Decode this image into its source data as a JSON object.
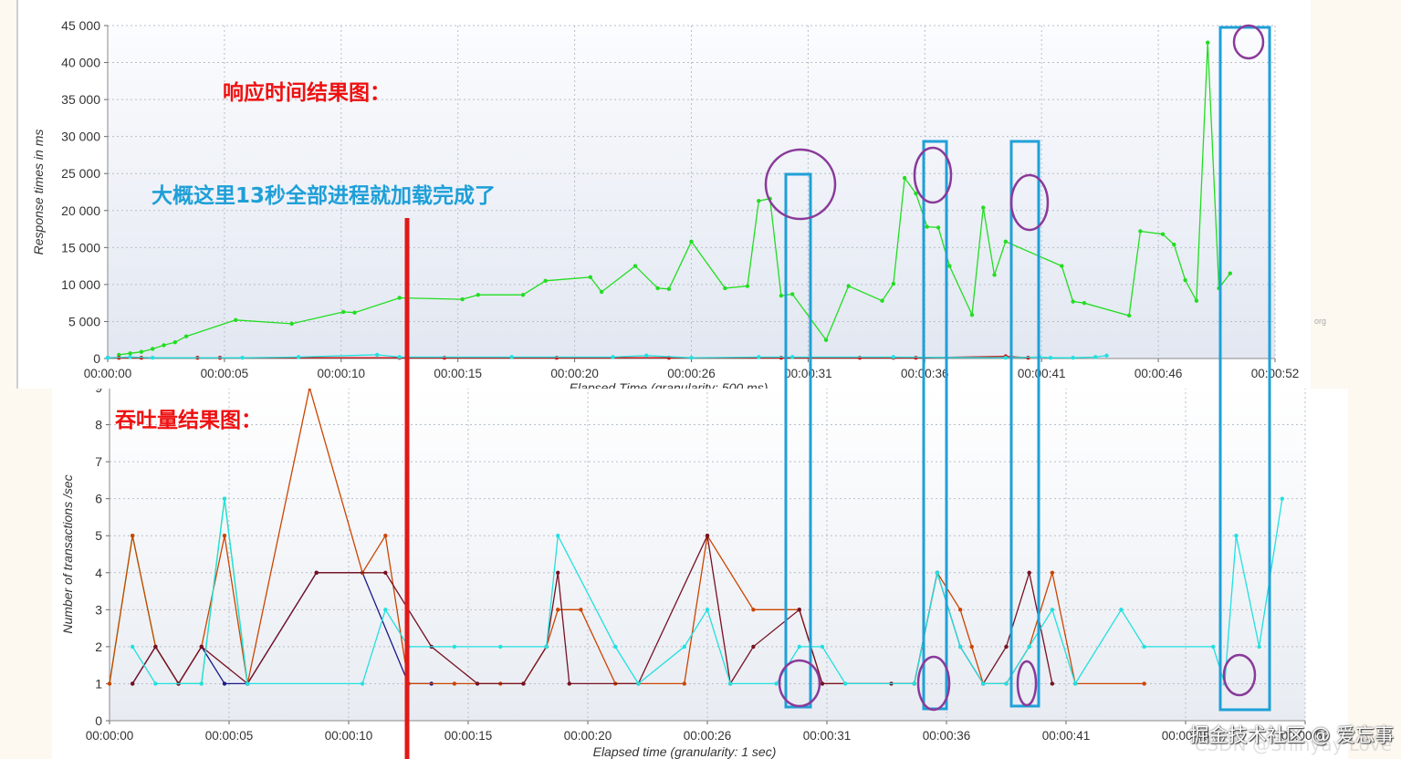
{
  "annotations": {
    "response_title": "响应时间结果图：",
    "throughput_title": "吞吐量结果图：",
    "load_note": "大概这里13秒全部进程就加载完成了"
  },
  "watermark": {
    "front": "掘金技术社区 @ 爱忘事",
    "back": "CSDN @Shinyay Love"
  },
  "org_tag": "org",
  "colors": {
    "green": "#22dd22",
    "red": "#cc1111",
    "cyan": "#22e0e0",
    "orange": "#cc4400",
    "darkred": "#771122",
    "navy": "#1a1a88",
    "annotation_red": "#ee1111",
    "annotation_blue": "#1e9fd8",
    "box_blue": "#1fa0d8",
    "circle_purple": "#8a3a9a",
    "marker_line": "#e21818"
  },
  "chart_data": [
    {
      "type": "line",
      "ylabel": "Response times in ms",
      "xlabel": "Elapsed Time (granularity: 500 ms)",
      "ylim": [
        0,
        45000
      ],
      "xlim": [
        0,
        52
      ],
      "yticks": [
        "0",
        "5 000",
        "10 000",
        "15 000",
        "20 000",
        "25 000",
        "30 000",
        "35 000",
        "40 000",
        "45 000"
      ],
      "xticks": [
        "00:00:00",
        "00:00:05",
        "00:00:10",
        "00:00:15",
        "00:00:20",
        "00:00:26",
        "00:00:31",
        "00:00:36",
        "00:00:41",
        "00:00:46",
        "00:00:52"
      ],
      "grid": true,
      "series": [
        {
          "color": "green",
          "points": [
            [
              0.5,
              500
            ],
            [
              1,
              700
            ],
            [
              1.5,
              900
            ],
            [
              2,
              1300
            ],
            [
              2.5,
              1800
            ],
            [
              3,
              2200
            ],
            [
              3.5,
              3000
            ],
            [
              5.7,
              5200
            ],
            [
              8.2,
              4700
            ],
            [
              10.5,
              6300
            ],
            [
              11,
              6200
            ],
            [
              13,
              8200
            ],
            [
              15.8,
              8000
            ],
            [
              16.5,
              8600
            ],
            [
              18.5,
              8600
            ],
            [
              19.5,
              10500
            ],
            [
              21.5,
              11000
            ],
            [
              22,
              9000
            ],
            [
              23.5,
              12500
            ],
            [
              24.5,
              9500
            ],
            [
              25,
              9400
            ],
            [
              26,
              15800
            ],
            [
              27.5,
              9500
            ],
            [
              28.5,
              9800
            ],
            [
              29,
              21300
            ],
            [
              29.5,
              21600
            ],
            [
              30,
              8500
            ],
            [
              30.5,
              8700
            ],
            [
              32,
              2500
            ],
            [
              33,
              9800
            ],
            [
              34.5,
              7800
            ],
            [
              35,
              10100
            ],
            [
              35.5,
              24400
            ],
            [
              36,
              22300
            ],
            [
              36.5,
              17800
            ],
            [
              37,
              17700
            ],
            [
              37.5,
              12500
            ],
            [
              38.5,
              5900
            ],
            [
              39,
              20400
            ],
            [
              39.5,
              11300
            ],
            [
              40,
              15800
            ],
            [
              42.5,
              12500
            ],
            [
              43,
              7700
            ],
            [
              43.5,
              7500
            ],
            [
              45.5,
              5800
            ],
            [
              46,
              17200
            ],
            [
              47,
              16800
            ],
            [
              47.5,
              15400
            ],
            [
              48,
              10600
            ],
            [
              48.5,
              7800
            ],
            [
              49,
              42700
            ],
            [
              49.5,
              9500
            ],
            [
              50,
              11500
            ]
          ]
        },
        {
          "color": "red",
          "points": [
            [
              0,
              100
            ],
            [
              0.5,
              100
            ],
            [
              1.5,
              100
            ],
            [
              4,
              100
            ],
            [
              5,
              100
            ],
            [
              13,
              100
            ],
            [
              15,
              100
            ],
            [
              20,
              100
            ],
            [
              25,
              100
            ],
            [
              30,
              100
            ],
            [
              33.5,
              100
            ],
            [
              35,
              100
            ],
            [
              36,
              100
            ],
            [
              40,
              300
            ],
            [
              41,
              100
            ]
          ]
        },
        {
          "color": "cyan",
          "points": [
            [
              0,
              100
            ],
            [
              1,
              200
            ],
            [
              2,
              100
            ],
            [
              6,
              100
            ],
            [
              8.5,
              200
            ],
            [
              12,
              500
            ],
            [
              13,
              200
            ],
            [
              18,
              200
            ],
            [
              22.5,
              200
            ],
            [
              24,
              400
            ],
            [
              26,
              100
            ],
            [
              29,
              200
            ],
            [
              30.5,
              200
            ],
            [
              35,
              200
            ],
            [
              40,
              100
            ],
            [
              41.5,
              200
            ],
            [
              42,
              100
            ],
            [
              43,
              100
            ],
            [
              44,
              200
            ],
            [
              44.5,
              400
            ]
          ]
        }
      ]
    },
    {
      "type": "line",
      "ylabel": "Number of transactions /sec",
      "xlabel": "Elapsed time (granularity: 1 sec)",
      "ylim": [
        0,
        9
      ],
      "xlim": [
        0,
        52
      ],
      "yticks": [
        "0",
        "1",
        "2",
        "3",
        "4",
        "5",
        "6",
        "7",
        "8",
        "9"
      ],
      "xticks": [
        "00:00:00",
        "00:00:05",
        "00:00:10",
        "00:00:15",
        "00:00:20",
        "00:00:26",
        "00:00:31",
        "00:00:36",
        "00:00:41",
        "00:00:46",
        "00:00:52"
      ],
      "grid": true,
      "series": [
        {
          "color": "green",
          "points": [
            [
              0,
              1
            ],
            [
              1,
              5
            ],
            [
              2,
              2
            ],
            [
              3,
              1
            ],
            [
              4,
              1
            ],
            [
              5,
              6
            ],
            [
              6,
              1
            ]
          ]
        },
        {
          "color": "navy",
          "points": [
            [
              1,
              1
            ],
            [
              2,
              2
            ],
            [
              3,
              1
            ],
            [
              4,
              2
            ],
            [
              5,
              1
            ],
            [
              6,
              1
            ],
            [
              9,
              4
            ],
            [
              11,
              4
            ],
            [
              13,
              1
            ],
            [
              14,
              1
            ]
          ]
        },
        {
          "color": "orange",
          "points": [
            [
              0,
              1
            ],
            [
              1,
              5
            ],
            [
              2,
              2
            ],
            [
              3,
              1
            ],
            [
              4,
              2
            ],
            [
              5,
              5
            ],
            [
              6,
              1
            ],
            [
              8.7,
              9
            ],
            [
              11,
              4
            ],
            [
              12,
              5
            ],
            [
              13,
              1
            ],
            [
              15,
              1
            ],
            [
              17,
              1
            ],
            [
              18,
              1
            ],
            [
              19,
              2
            ],
            [
              19.5,
              3
            ],
            [
              20.5,
              3
            ],
            [
              22,
              1
            ],
            [
              25,
              1
            ],
            [
              26,
              5
            ],
            [
              28,
              3
            ],
            [
              30,
              3
            ],
            [
              31,
              1
            ],
            [
              35,
              1
            ],
            [
              36,
              4
            ],
            [
              37,
              3
            ],
            [
              37.5,
              2
            ],
            [
              38,
              1
            ],
            [
              39,
              1
            ],
            [
              40,
              2
            ],
            [
              41,
              4
            ],
            [
              42,
              1
            ],
            [
              45,
              1
            ]
          ]
        },
        {
          "color": "darkred",
          "points": [
            [
              1,
              1
            ],
            [
              2,
              2
            ],
            [
              3,
              1
            ],
            [
              4,
              2
            ],
            [
              6,
              1
            ],
            [
              9,
              4
            ],
            [
              12,
              4
            ],
            [
              14,
              2
            ],
            [
              16,
              1
            ],
            [
              18,
              1
            ],
            [
              19,
              2
            ],
            [
              19.5,
              4
            ],
            [
              20,
              1
            ],
            [
              23,
              1
            ],
            [
              26,
              5
            ],
            [
              27,
              1
            ],
            [
              28,
              2
            ],
            [
              30,
              3
            ],
            [
              31,
              1
            ],
            [
              34,
              1
            ],
            [
              35,
              1
            ],
            [
              36,
              4
            ],
            [
              37,
              2
            ],
            [
              38,
              1
            ],
            [
              39,
              2
            ],
            [
              40,
              4
            ],
            [
              41,
              1
            ]
          ]
        },
        {
          "color": "cyan",
          "points": [
            [
              1,
              2
            ],
            [
              2,
              1
            ],
            [
              4,
              1
            ],
            [
              5,
              6
            ],
            [
              6,
              1
            ],
            [
              11,
              1
            ],
            [
              12,
              3
            ],
            [
              13,
              2
            ],
            [
              15,
              2
            ],
            [
              17,
              2
            ],
            [
              19,
              2
            ],
            [
              19.5,
              5
            ],
            [
              22,
              2
            ],
            [
              23,
              1
            ],
            [
              25,
              2
            ],
            [
              26,
              3
            ],
            [
              27,
              1
            ],
            [
              29,
              1
            ],
            [
              30,
              2
            ],
            [
              31,
              2
            ],
            [
              32,
              1
            ],
            [
              35,
              1
            ],
            [
              36,
              4
            ],
            [
              37,
              2
            ],
            [
              38,
              1
            ],
            [
              39,
              1
            ],
            [
              40,
              2
            ],
            [
              41,
              3
            ],
            [
              42,
              1
            ],
            [
              44,
              3
            ],
            [
              45,
              2
            ],
            [
              48,
              2
            ],
            [
              48.5,
              1
            ],
            [
              49,
              5
            ],
            [
              50,
              2
            ],
            [
              51,
              6
            ]
          ]
        }
      ]
    }
  ]
}
